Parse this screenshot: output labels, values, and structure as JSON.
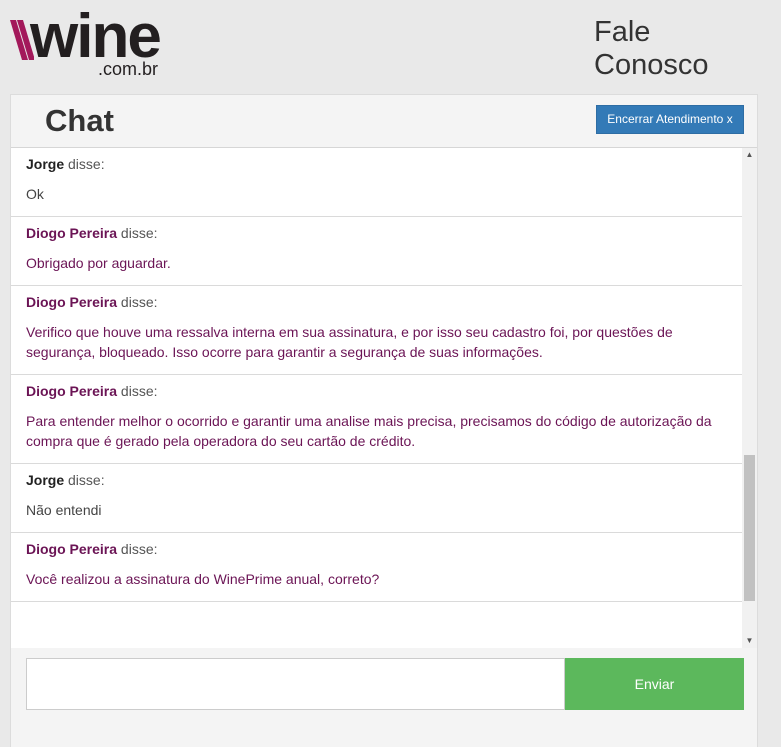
{
  "header": {
    "logo_word": "wine",
    "logo_domain": ".com.br",
    "contact_line1": "Fale",
    "contact_line2": "Conosco"
  },
  "chat": {
    "title": "Chat",
    "end_button": "Encerrar Atendimento x",
    "said_label": "disse:",
    "messages": [
      {
        "author": "Jorge",
        "role": "user",
        "text": "Ok"
      },
      {
        "author": "Diogo Pereira",
        "role": "agent",
        "text": "Obrigado por aguardar."
      },
      {
        "author": "Diogo Pereira",
        "role": "agent",
        "text": "Verifico que houve uma ressalva interna em sua assinatura, e por isso seu cadastro foi, por questões de segurança, bloqueado. Isso ocorre para garantir a segurança de suas informações."
      },
      {
        "author": "Diogo Pereira",
        "role": "agent",
        "text": "Para entender melhor o ocorrido e garantir uma analise mais precisa, precisamos do código de autorização da compra que é gerado pela operadora do seu cartão de crédito."
      },
      {
        "author": "Jorge",
        "role": "user",
        "text": "Não entendi"
      },
      {
        "author": "Diogo Pereira",
        "role": "agent",
        "text": "Você realizou a assinatura do WinePrime anual, correto?"
      }
    ],
    "input_value": "",
    "send_button": "Enviar",
    "scroll_up_glyph": "▲",
    "scroll_down_glyph": "▼"
  },
  "colors": {
    "agent": "#6b1455",
    "end_button_bg": "#337ab7",
    "send_button_bg": "#5cb85c",
    "logo_accent": "#a3195b"
  },
  "icons": {
    "logo_mark": "wine-slash-logo-icon"
  }
}
